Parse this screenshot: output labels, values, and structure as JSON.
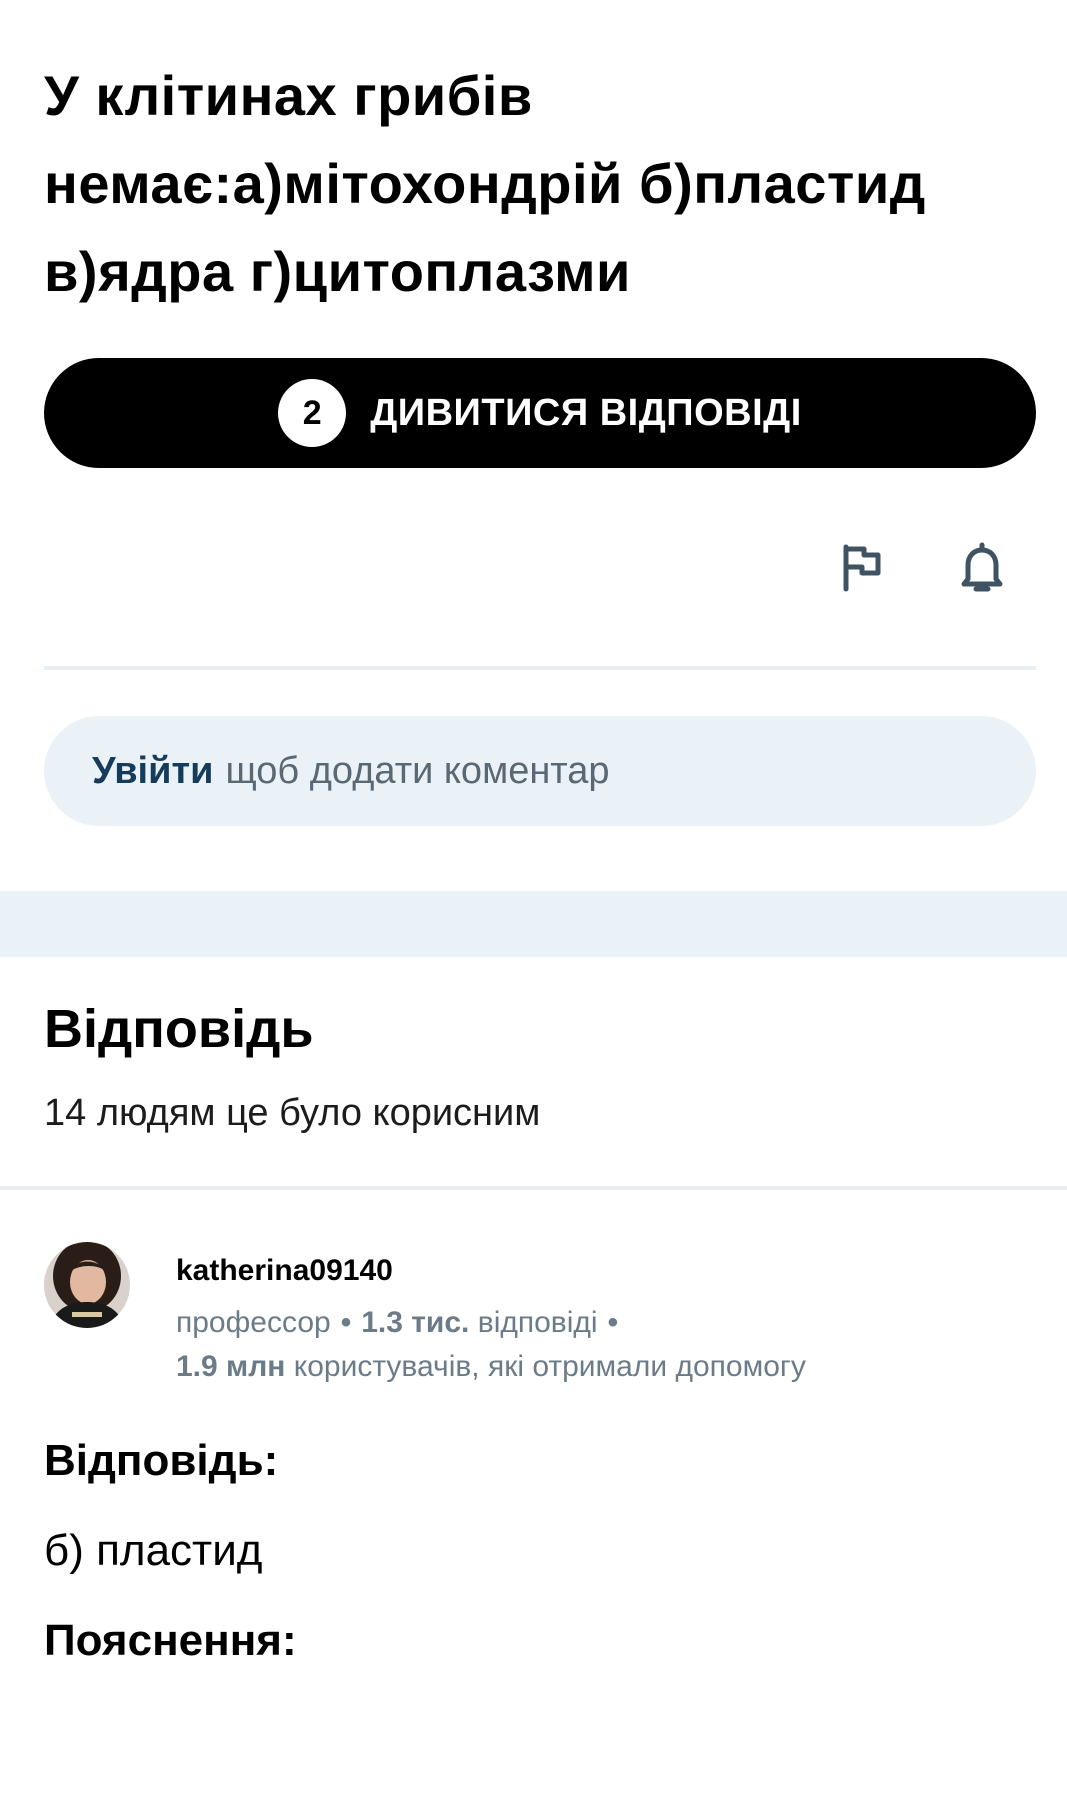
{
  "question": {
    "line1": "У клітинах грибів",
    "line2": "немає:а)мітохондрій б)пластид",
    "line3": "в)ядра г)цитоплазми"
  },
  "answers_button": {
    "count": "2",
    "label": "ДИВИТИСЯ ВІДПОВІДІ"
  },
  "actions": {
    "icons": [
      "flag-icon",
      "bell-icon"
    ]
  },
  "comment": {
    "login_label": "Увійти",
    "hint": "щоб додати коментар"
  },
  "answer_section": {
    "heading": "Відповідь",
    "helpful": "14 людям це було корисним"
  },
  "author": {
    "username": "katherina09140",
    "rank": "профессор",
    "answers_count": "1.3 тис.",
    "answers_label": "відповіді",
    "helped_count": "1.9 млн",
    "helped_label": "користувачів, які отримали допомогу"
  },
  "answer_body": {
    "label": "Відповідь:",
    "value": "б) пластид",
    "explanation_label": "Пояснення:"
  },
  "colors": {
    "primary": "#000000",
    "accent_link": "#163c5c",
    "muted_text": "#6b7b88",
    "light_band": "#ebf2f7"
  }
}
